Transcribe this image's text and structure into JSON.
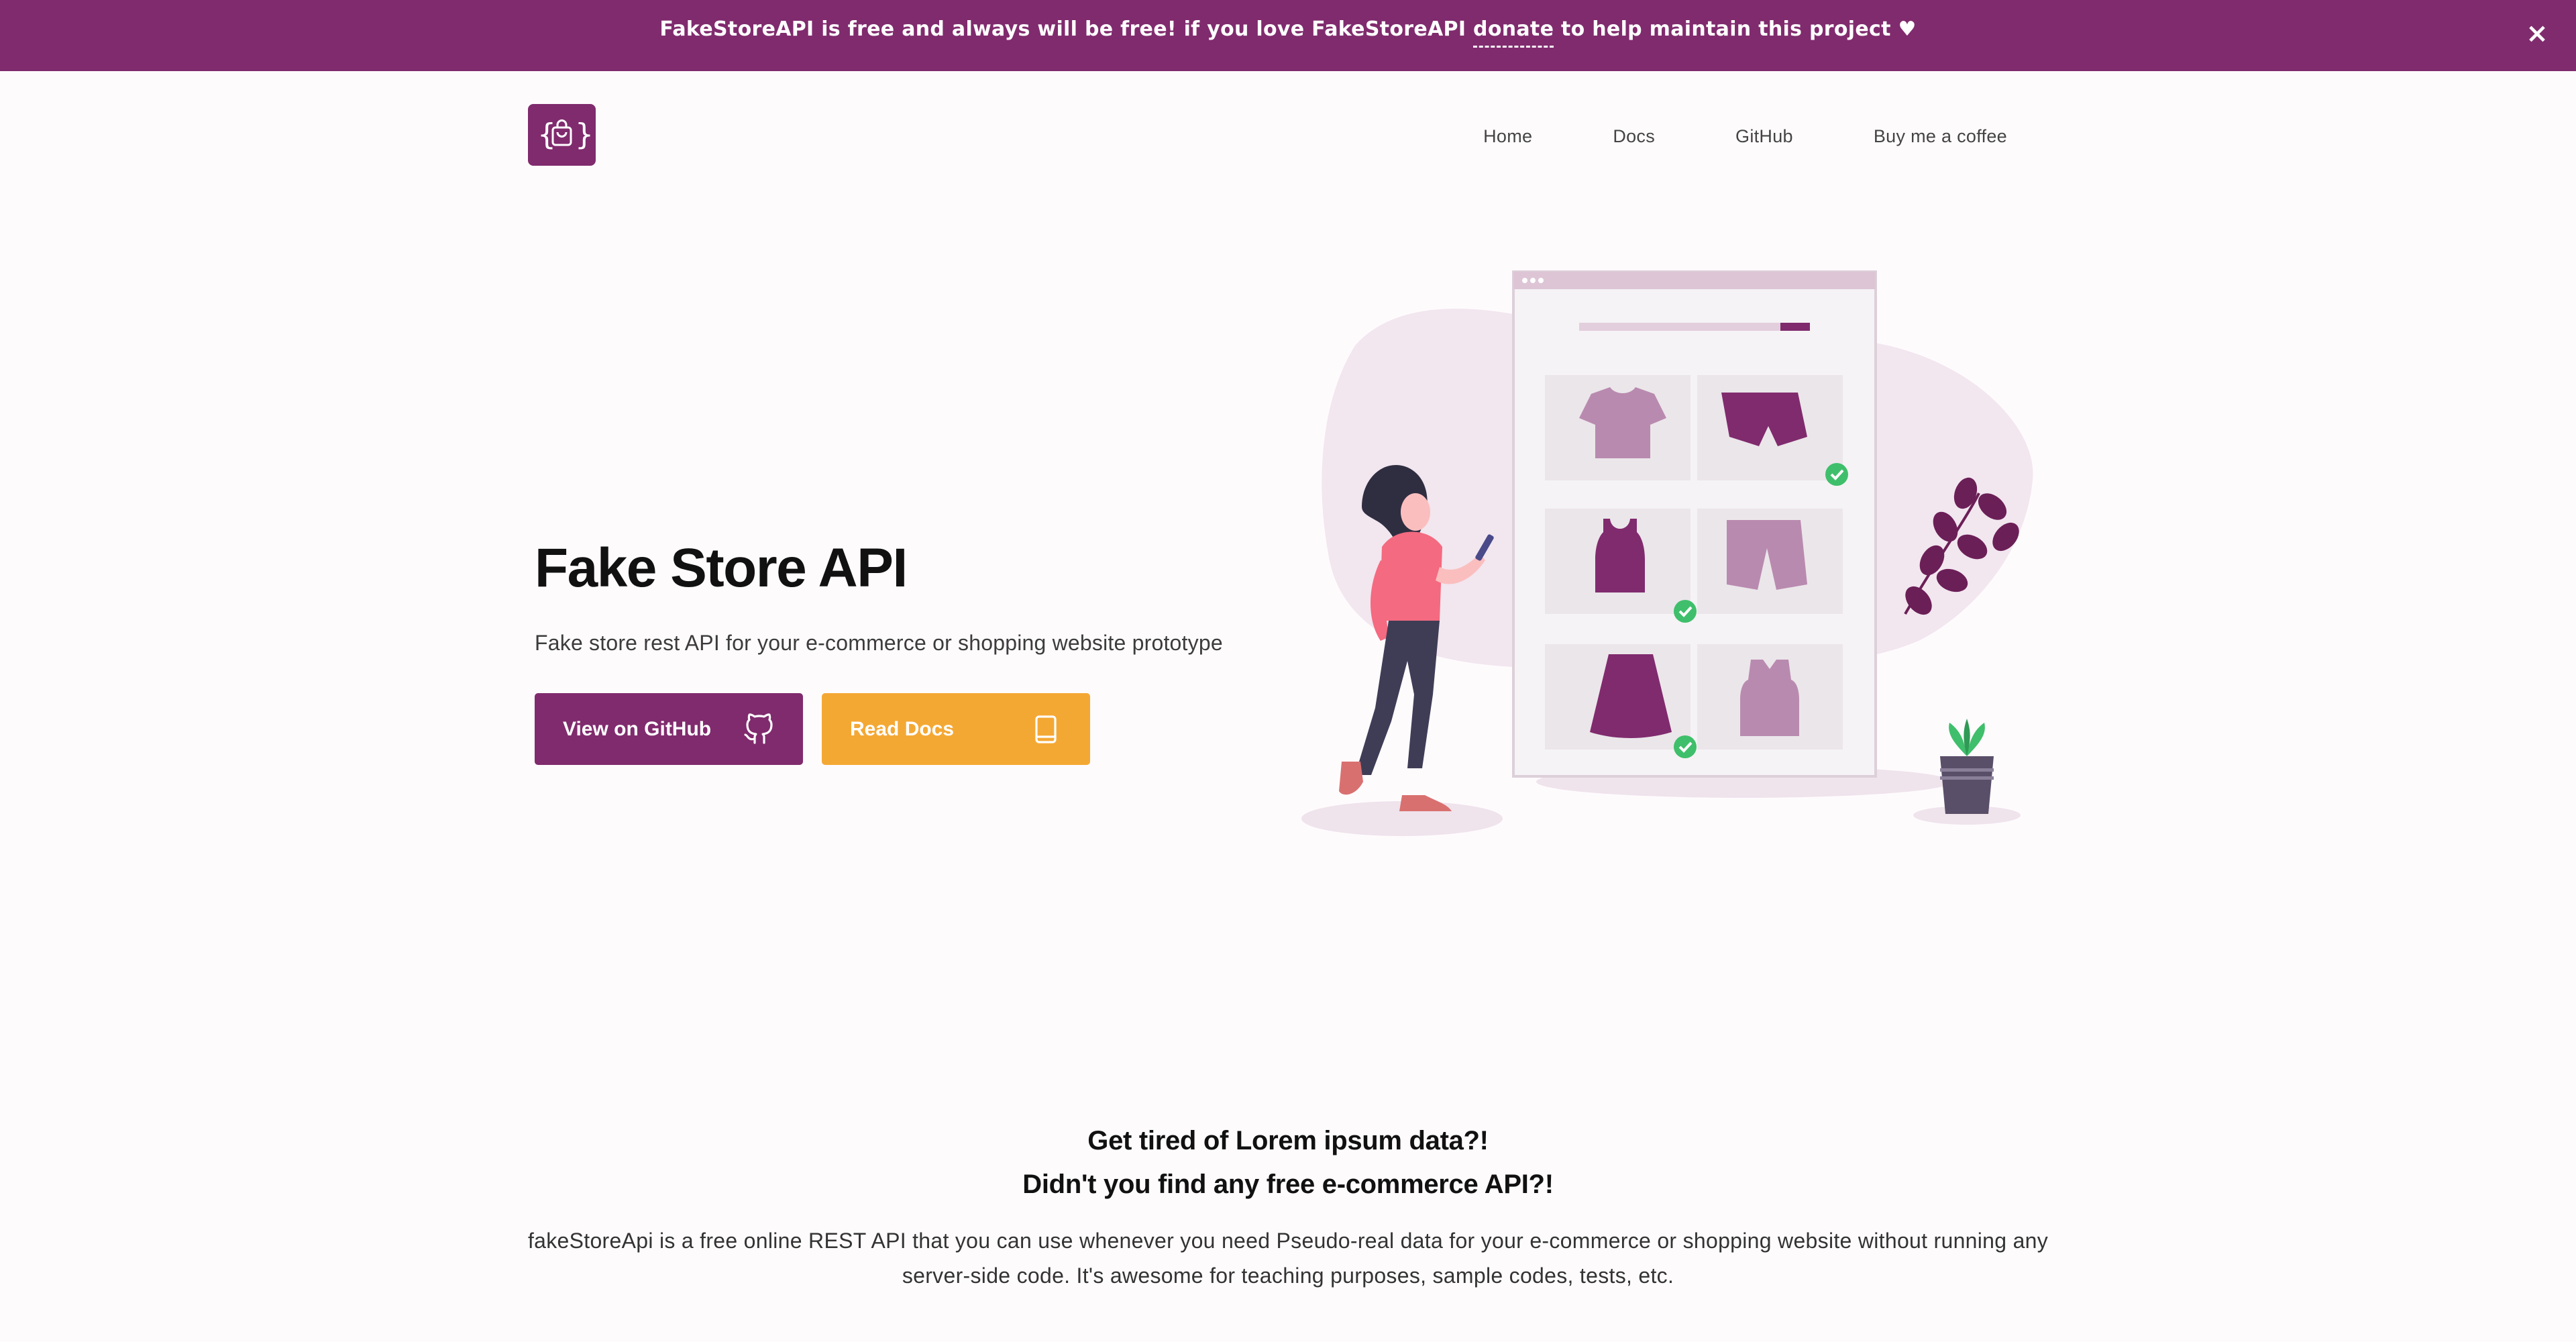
{
  "banner": {
    "text_before": "FakeStoreAPI is free and always will be free! if you love FakeStoreAPI ",
    "link": "donate",
    "text_after": " to help maintain this project ♥",
    "close": "×"
  },
  "nav": {
    "items": [
      {
        "label": "Home"
      },
      {
        "label": "Docs"
      },
      {
        "label": "GitHub"
      },
      {
        "label": "Buy me a coffee"
      }
    ]
  },
  "hero": {
    "title": "Fake Store API",
    "subtitle": "Fake store rest API for your e-commerce or shopping website prototype",
    "github_button": "View on GitHub",
    "docs_button": "Read Docs"
  },
  "about": {
    "heading1": "Get tired of Lorem ipsum data?!",
    "heading2": "Didn't you find any free e-commerce API?!",
    "paragraph_line1": "fakeStoreApi is a free online REST API that you can use whenever you need Pseudo-real data for your e-commerce or shopping website without running any",
    "paragraph_line2": "server-side code. It's awesome for teaching purposes, sample codes, tests, etc."
  },
  "colors": {
    "brand": "#802b6e",
    "accent": "#f4a834",
    "check": "#3fbf6b"
  },
  "icons": {
    "logo": "shopping-bag-braces-icon",
    "github": "github-icon",
    "docs": "book-icon",
    "close": "close-icon"
  }
}
